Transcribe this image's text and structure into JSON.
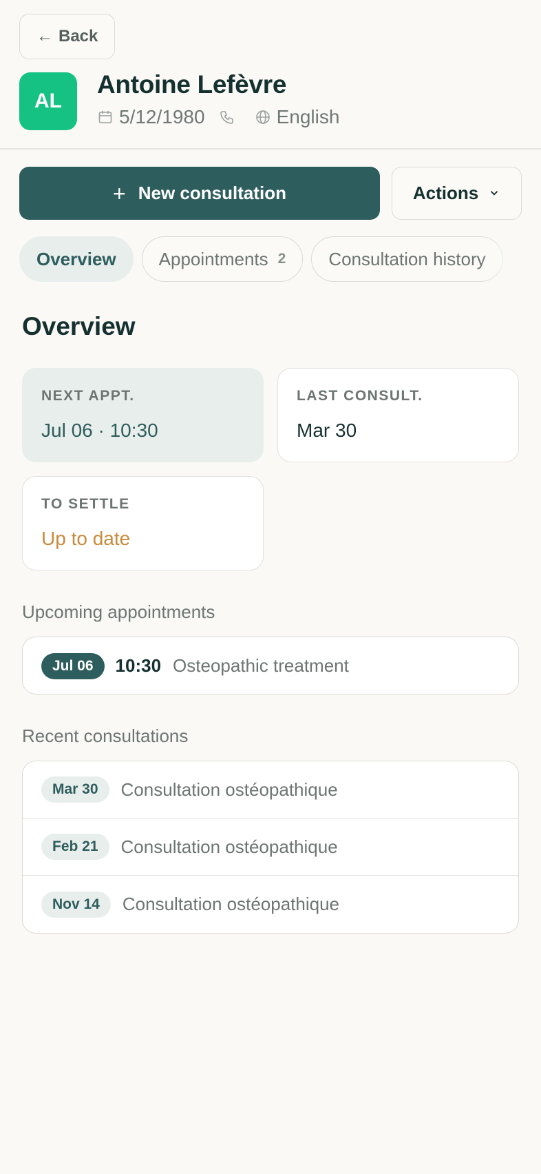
{
  "header": {
    "back_label": "Back",
    "back_arrow": "←",
    "avatar_initials": "AL",
    "patient_name": "Antoine Lefèvre",
    "birth_date": "5/12/1980",
    "language": "English"
  },
  "actions": {
    "new_consultation_label": "New consultation",
    "plus_glyph": "+",
    "actions_label": "Actions"
  },
  "tabs": [
    {
      "label": "Overview",
      "count": ""
    },
    {
      "label": "Appointments",
      "count": "2"
    },
    {
      "label": "Consultation history",
      "count": ""
    }
  ],
  "overview": {
    "title": "Overview",
    "cards": [
      {
        "label": "NEXT APPT.",
        "value": "Jul 06 · 10:30"
      },
      {
        "label": "LAST CONSULT.",
        "value": "Mar 30"
      },
      {
        "label": "TO SETTLE",
        "value": "Up to date"
      }
    ]
  },
  "upcoming": {
    "title": "Upcoming appointments",
    "items": [
      {
        "date": "Jul 06",
        "time": "10:30",
        "label": "Osteopathic treatment"
      }
    ]
  },
  "recent": {
    "title": "Recent consultations",
    "items": [
      {
        "date": "Mar 30",
        "label": "Consultation ostéopathique"
      },
      {
        "date": "Feb 21",
        "label": "Consultation ostéopathique"
      },
      {
        "date": "Nov 14",
        "label": "Consultation ostéopathique"
      }
    ]
  },
  "colors": {
    "accent": "#2e5d5d",
    "avatar_bg": "#15c283",
    "warn": "#c98a3b",
    "background": "#faf9f6"
  },
  "icons": {
    "calendar": "calendar-icon",
    "phone": "phone-icon",
    "globe": "globe-icon",
    "chevron": "chevron-down-icon"
  }
}
